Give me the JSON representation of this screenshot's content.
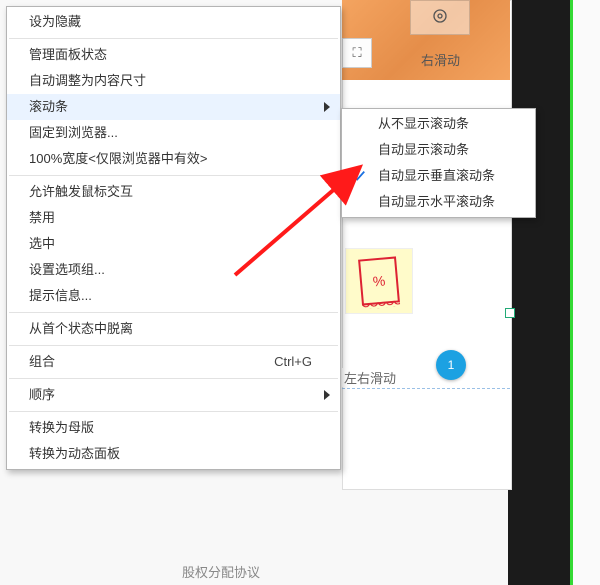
{
  "background": {
    "swipe_label_top": "右滑动",
    "swipe_label_mid": "左右滑动",
    "blue_badge": "1",
    "bottom_text": "股权分配协议",
    "stamp_text": "%",
    "fullscreen_glyph": "⛶"
  },
  "menu": {
    "set_hidden": "设为隐藏",
    "manage_panel_states": "管理面板状态",
    "auto_fit_content": "自动调整为内容尺寸",
    "scrollbar": "滚动条",
    "pin_to_browser": "固定到浏览器...",
    "hundred_width": "100%宽度<仅限浏览器中有效>",
    "allow_mouse_interactions": "允许触发鼠标交互",
    "disable": "禁用",
    "selected": "选中",
    "set_option_group": "设置选项组...",
    "tooltip": "提示信息...",
    "break_from_first_state": "从首个状态中脱离",
    "group": "组合",
    "group_shortcut": "Ctrl+G",
    "order": "顺序",
    "convert_to_master": "转换为母版",
    "convert_to_dynamic_panel": "转换为动态面板"
  },
  "submenu": {
    "never_show": "从不显示滚动条",
    "auto_show": "自动显示滚动条",
    "auto_vertical": "自动显示垂直滚动条",
    "auto_horizontal": "自动显示水平滚动条"
  }
}
